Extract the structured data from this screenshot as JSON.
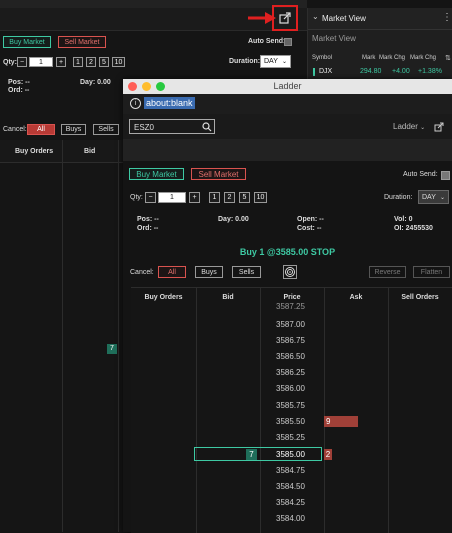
{
  "background": {
    "buy_market": "Buy Market",
    "sell_market": "Sell Market",
    "auto_send": "Auto Send:",
    "duration_label": "Duration:",
    "duration_value": "DAY",
    "qty_label": "Qty:",
    "qty_value": "1",
    "qty_presets": [
      "1",
      "2",
      "5",
      "10"
    ],
    "pos": "Pos: --",
    "ord": "Ord: --",
    "day": "Day: 0.00",
    "cancel_label": "Cancel:",
    "cancel_all": "All",
    "cancel_buys": "Buys",
    "cancel_sells": "Sells",
    "col_buy_orders": "Buy Orders",
    "col_bid": "Bid",
    "bid_size": "7"
  },
  "market_view": {
    "title": "Market View",
    "subtitle": "Market View",
    "columns": [
      "Symbol",
      "Mark",
      "Mark Chg",
      "Mark Chg"
    ],
    "row": {
      "symbol": "DJX",
      "mark": "294.80",
      "chg": "+4.00",
      "chg_pct": "+1.38%"
    }
  },
  "ladder_window": {
    "title": "Ladder",
    "url": "about:blank",
    "symbol": "ESZ0",
    "dropdown_label": "Ladder",
    "buy_market": "Buy Market",
    "sell_market": "Sell Market",
    "auto_send": "Auto Send:",
    "qty_label": "Qty:",
    "qty_value": "1",
    "qty_presets": [
      "1",
      "2",
      "5",
      "10"
    ],
    "duration_label": "Duration:",
    "duration_value": "DAY",
    "stats": {
      "pos": "Pos: --",
      "ord": "Ord: --",
      "day": "Day: 0.00",
      "open": "Open: --",
      "cost": "Cost: --",
      "vol": "Vol: 0",
      "oi": "OI: 2455530"
    },
    "order_preview": "Buy 1 @3585.00 STOP",
    "cancel_label": "Cancel:",
    "cancel_all": "All",
    "cancel_buys": "Buys",
    "cancel_sells": "Sells",
    "reverse": "Reverse",
    "flatten": "Flatten",
    "columns": [
      "Buy Orders",
      "Bid",
      "Price",
      "Ask",
      "Sell Orders"
    ],
    "prices": [
      "3587.25",
      "3587.00",
      "3586.75",
      "3586.50",
      "3586.25",
      "3586.00",
      "3585.75",
      "3585.50",
      "3585.25",
      "3585.00",
      "3584.75",
      "3584.50",
      "3584.25",
      "3584.00"
    ],
    "ask_at_3585_50": "9",
    "ask_at_3585_00": "2",
    "bid_at_3585_00": "7"
  },
  "colors": {
    "accent_green": "#3ec9a3",
    "accent_red": "#d9534f",
    "annotation_red": "#e02020",
    "bid_fill": "#1f6e5a",
    "ask_fill": "#a04038"
  }
}
